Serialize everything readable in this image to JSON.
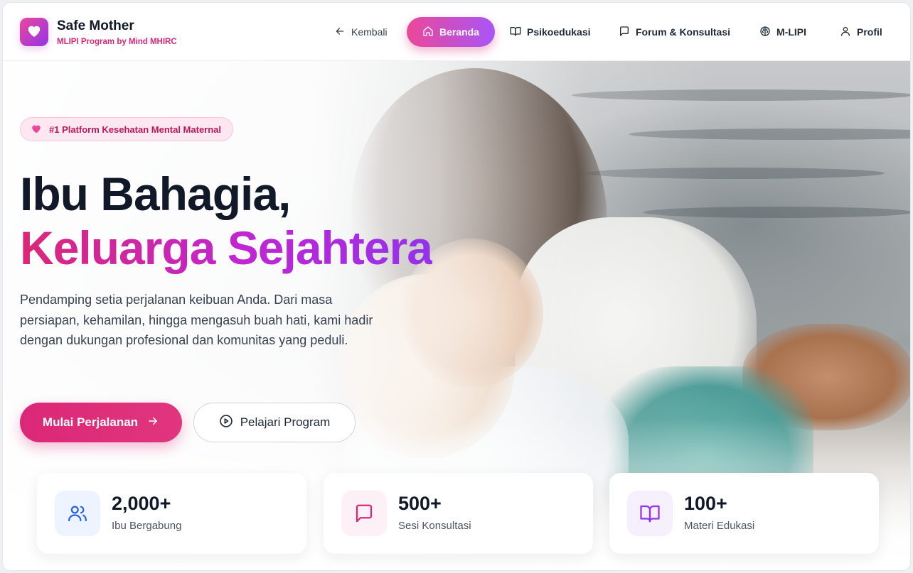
{
  "brand": {
    "title": "Safe Mother",
    "subtitle": "MLIPI Program by Mind MHIRC",
    "logo_icon": "heart-icon",
    "accent": "#db2777",
    "secondary_accent": "#9333ea"
  },
  "nav": {
    "back": {
      "label": "Kembali",
      "icon": "arrow-left-icon"
    },
    "items": [
      {
        "label": "Beranda",
        "icon": "home-icon",
        "active": true
      },
      {
        "label": "Psikoedukasi",
        "icon": "book-open-icon",
        "active": false
      },
      {
        "label": "Forum & Konsultasi",
        "icon": "message-square-icon",
        "active": false
      },
      {
        "label": "M-LIPI",
        "icon": "brain-icon",
        "active": false
      },
      {
        "label": "Profil",
        "icon": "user-icon",
        "active": false
      }
    ]
  },
  "hero": {
    "badge": "#1 Platform Kesehatan Mental Maternal",
    "headline_line1": "Ibu Bahagia,",
    "headline_line2": "Keluarga Sejahtera",
    "description": "Pendamping setia perjalanan keibuan Anda. Dari masa persiapan, kehamilan, hingga mengasuh buah hati, kami hadir dengan dukungan profesional dan komunitas yang peduli.",
    "primary_cta": "Mulai Perjalanan",
    "secondary_cta": "Pelajari Program"
  },
  "stats": [
    {
      "value": "2,000+",
      "label": "Ibu Bergabung",
      "icon": "users-icon",
      "color": "#2563eb",
      "bg": "#eef4ff"
    },
    {
      "value": "500+",
      "label": "Sesi Konsultasi",
      "icon": "message-square-icon",
      "color": "#db2777",
      "bg": "#fdf0f6"
    },
    {
      "value": "100+",
      "label": "Materi Edukasi",
      "icon": "book-open-icon",
      "color": "#9333ea",
      "bg": "#f6f0fd"
    }
  ]
}
